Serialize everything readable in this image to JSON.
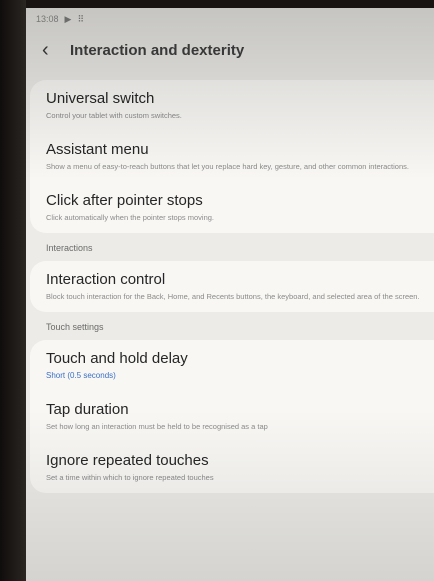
{
  "status_bar": {
    "time": "13:08",
    "icons": [
      "play-icon",
      "grid-icon"
    ]
  },
  "header": {
    "back_icon": "chevron-left-icon",
    "title": "Interaction and dexterity"
  },
  "group1": {
    "items": [
      {
        "title": "Universal switch",
        "subtitle": "Control your tablet with custom switches."
      },
      {
        "title": "Assistant menu",
        "subtitle": "Show a menu of easy-to-reach buttons that let you replace hard key, gesture, and other common interactions."
      },
      {
        "title": "Click after pointer stops",
        "subtitle": "Click automatically when the pointer stops moving."
      }
    ]
  },
  "interactions": {
    "header": "Interactions",
    "items": [
      {
        "title": "Interaction control",
        "subtitle": "Block touch interaction for the Back, Home, and Recents buttons, the keyboard, and selected area of the screen."
      }
    ]
  },
  "touch_settings": {
    "header": "Touch settings",
    "items": [
      {
        "title": "Touch and hold delay",
        "subtitle": "Short (0.5 seconds)"
      },
      {
        "title": "Tap duration",
        "subtitle": "Set how long an interaction must be held to be recognised as a tap"
      },
      {
        "title": "Ignore repeated touches",
        "subtitle": "Set a time within which to ignore repeated touches"
      }
    ]
  },
  "colors": {
    "accent": "#3b6fc4",
    "background": "#ecebe7",
    "card": "#f8f7f4"
  }
}
